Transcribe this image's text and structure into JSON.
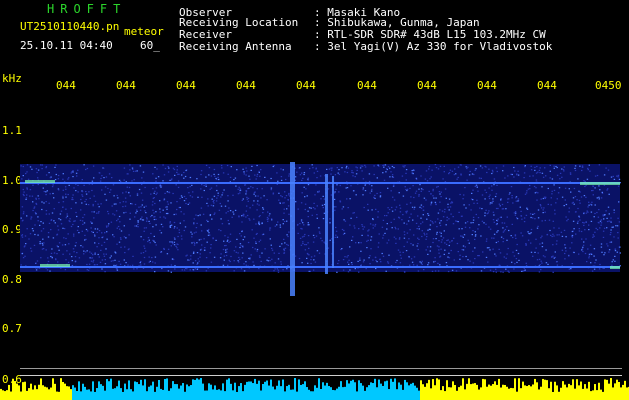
{
  "header": {
    "program": "HROFFT",
    "filename": "UT2510110440.pn",
    "mode": "meteor",
    "datetime": "25.10.11 04:40",
    "count": "60_",
    "fields": [
      {
        "label": "Observer",
        "value": ": Masaki Kano"
      },
      {
        "label": "Receiving Location",
        "value": ": Shibukawa, Gunma, Japan"
      },
      {
        "label": "Receiver",
        "value": ": RTL-SDR SDR# 43dB L15 103.2MHz CW"
      },
      {
        "label": "Receiving Antenna",
        "value": ": 3el Yagi(V) Az 330 for Vladivostok"
      }
    ]
  },
  "time_axis": {
    "ticks": [
      "044",
      "044",
      "044",
      "044",
      "044",
      "044",
      "044",
      "044",
      "044",
      "0450"
    ]
  },
  "freq_axis": {
    "unit": "kHz",
    "ticks": [
      "1.1",
      "1.0",
      "0.9",
      "0.8",
      "0.7",
      "0.6"
    ]
  },
  "colors": {
    "background": "#000000",
    "band": "#1a2a9a",
    "signal": "#4f7bff",
    "peak": "#7dffb0",
    "bottom_yellow": "#ffff00",
    "bottom_cyan": "#00c8ff"
  }
}
